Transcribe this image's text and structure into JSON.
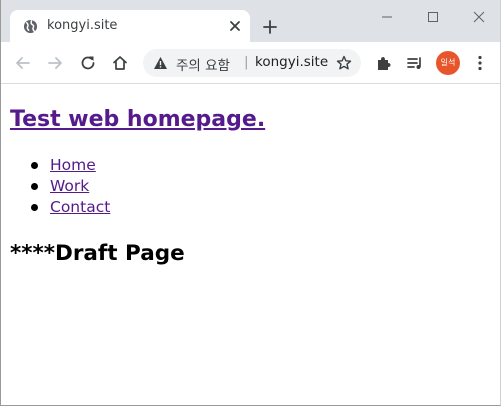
{
  "browser": {
    "tab": {
      "title": "kongyi.site",
      "favicon": "globe-icon"
    },
    "new_tab_icon": "plus-icon",
    "window_controls": [
      "minimize-icon",
      "maximize-icon",
      "close-icon"
    ],
    "toolbar": {
      "back_icon": "back-arrow-icon",
      "forward_icon": "forward-arrow-icon",
      "reload_icon": "reload-icon",
      "home_icon": "home-icon",
      "security_icon": "warning-icon",
      "security_label": "주의 요함",
      "separator": "|",
      "url": "kongyi.site",
      "bookmark_icon": "star-icon",
      "extensions_icon": "puzzle-icon",
      "media_icon": "media-queue-icon",
      "profile_label": "일석",
      "menu_icon": "three-dot-menu-icon"
    },
    "colors": {
      "tabstrip_bg": "#dee1e6",
      "omnibox_bg": "#f1f3f4",
      "profile_bg": "#e8552a",
      "visited_link": "#551a8b"
    }
  },
  "page": {
    "title": "Test web homepage.",
    "nav": [
      {
        "label": "Home"
      },
      {
        "label": "Work"
      },
      {
        "label": "Contact"
      }
    ],
    "heading": "****Draft Page"
  }
}
